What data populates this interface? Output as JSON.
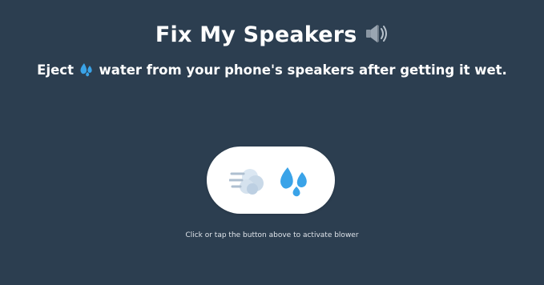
{
  "header": {
    "title": "Fix My Speakers",
    "title_icon": "speaker-icon",
    "subtitle_before": "Eject",
    "subtitle_icon": "water-droplets-icon",
    "subtitle_after": "water from your phone's speakers after getting it wet."
  },
  "blower": {
    "icons": [
      "dashing-away-icon",
      "water-droplets-icon"
    ]
  },
  "hint": {
    "text": "Click or tap the button above to activate blower"
  },
  "colors": {
    "background": "#2c3e50",
    "button": "#ffffff",
    "water": "#3aa3e8",
    "text": "#ffffff"
  }
}
